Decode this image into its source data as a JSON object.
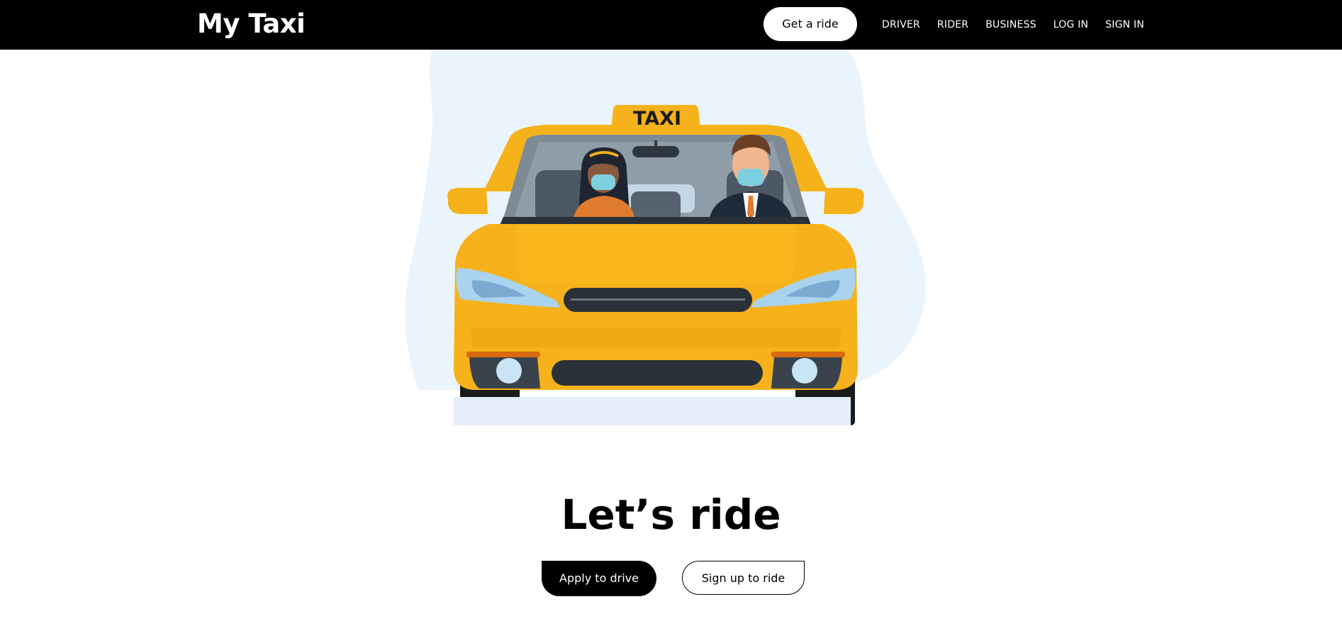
{
  "header": {
    "brand": "My Taxi",
    "cta_label": "Get a ride",
    "nav": [
      {
        "label": "DRIVER"
      },
      {
        "label": "RIDER"
      },
      {
        "label": "BUSINESS"
      },
      {
        "label": "LOG IN"
      },
      {
        "label": "SIGN IN"
      }
    ]
  },
  "hero": {
    "taxi_sign": "TAXI",
    "illustration_icon": "taxi-illustration"
  },
  "main": {
    "headline": "Let’s ride",
    "primary_button": "Apply to drive",
    "secondary_button": "Sign up to ride"
  },
  "colors": {
    "navbar": "#000000",
    "taxi_yellow": "#F7B21B",
    "blob": "#EAF4FD"
  }
}
